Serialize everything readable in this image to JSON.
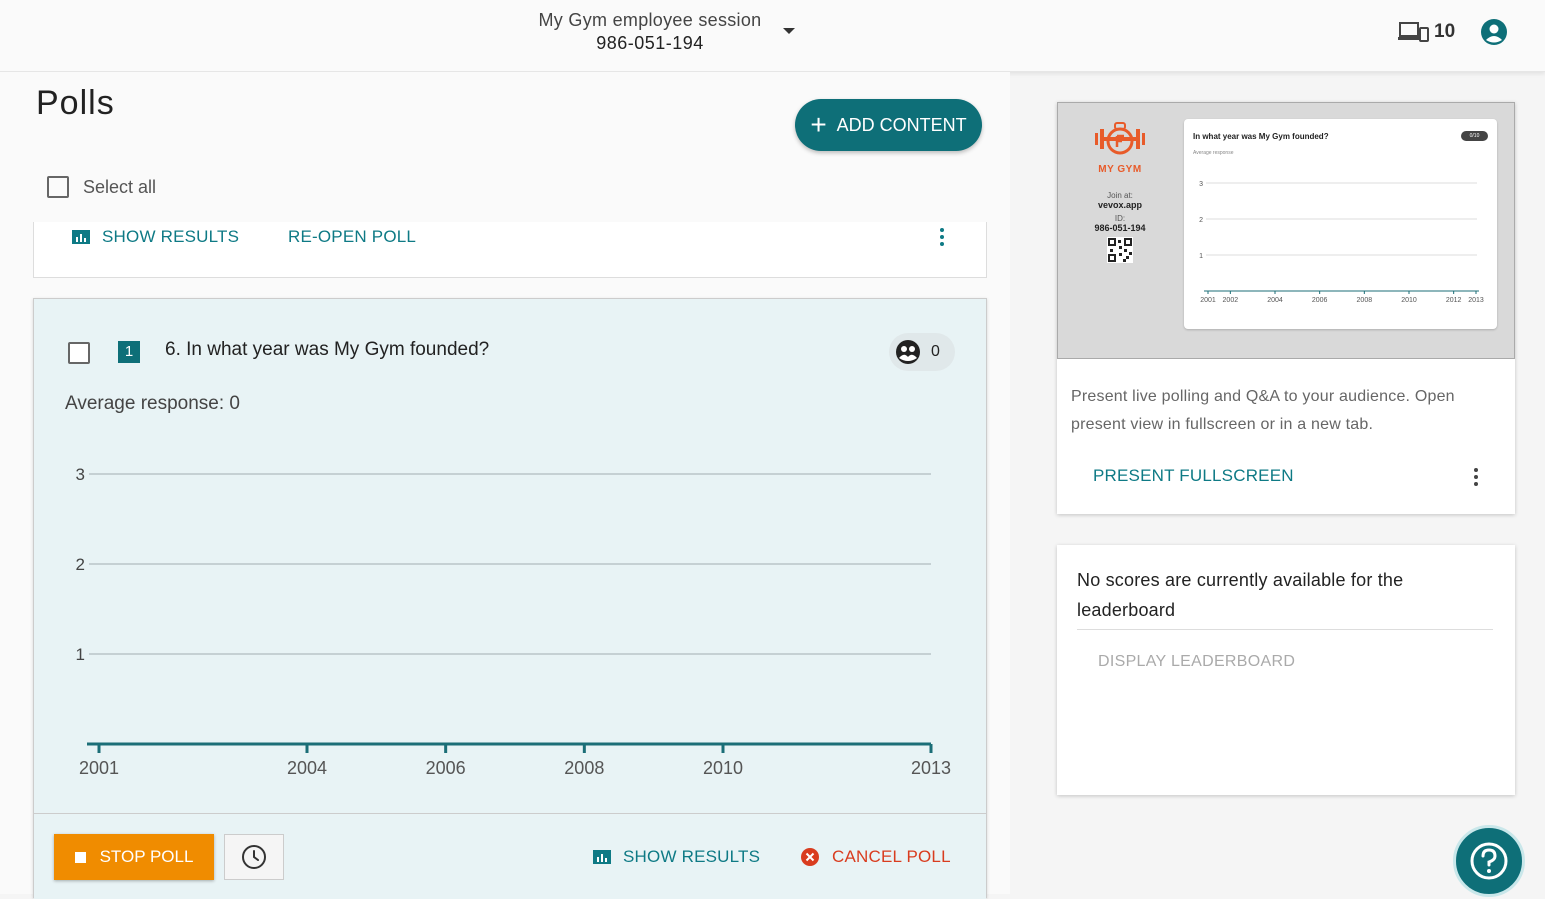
{
  "topbar": {
    "session_name": "My Gym employee session",
    "session_id": "986-051-194",
    "devices_count": "10",
    "icons": [
      "chevron-down-icon",
      "devices-icon",
      "user-icon"
    ]
  },
  "main": {
    "title": "Polls",
    "add_content_label": "ADD CONTENT",
    "select_all_label": "Select all"
  },
  "prev_poll": {
    "show_results_label": "SHOW RESULTS",
    "reopen_label": "RE-OPEN POLL"
  },
  "poll": {
    "number": "1",
    "question": "6. In what year was My Gym founded?",
    "responses": "0",
    "average_label": "Average response: 0",
    "stop_label": "STOP POLL",
    "show_results_label": "SHOW RESULTS",
    "cancel_label": "CANCEL POLL"
  },
  "chart_data": {
    "type": "bar",
    "categories": [
      "2001",
      "2004",
      "2006",
      "2008",
      "2010",
      "2013"
    ],
    "values": [
      0,
      0,
      0,
      0,
      0,
      0
    ],
    "y_ticks": [
      "1",
      "2",
      "3"
    ],
    "ylim": [
      0,
      3
    ],
    "xlim": [
      2001,
      2013
    ],
    "grid": true
  },
  "present": {
    "preview": {
      "brand": "MY GYM",
      "join_at": "Join at:",
      "join_url": "vevox.app",
      "id_label": "ID:",
      "id_value": "986-051-194",
      "question": "In what year was My Gym founded?",
      "avg": "Average response",
      "badge": "0/10",
      "y_ticks": [
        "1",
        "2",
        "3"
      ],
      "x_ticks": [
        "2001",
        "2002",
        "2004",
        "2006",
        "2008",
        "2010",
        "2012",
        "2013"
      ]
    },
    "description": "Present live polling and Q&A to your audience. Open present view in fullscreen or in a new tab.",
    "fullscreen_label": "PRESENT FULLSCREEN"
  },
  "leaderboard": {
    "message": "No scores are currently available for the leaderboard",
    "display_label": "DISPLAY LEADERBOARD"
  },
  "colors": {
    "teal": "#0e6f78",
    "orange": "#f08c00",
    "red": "#d93c1f"
  }
}
